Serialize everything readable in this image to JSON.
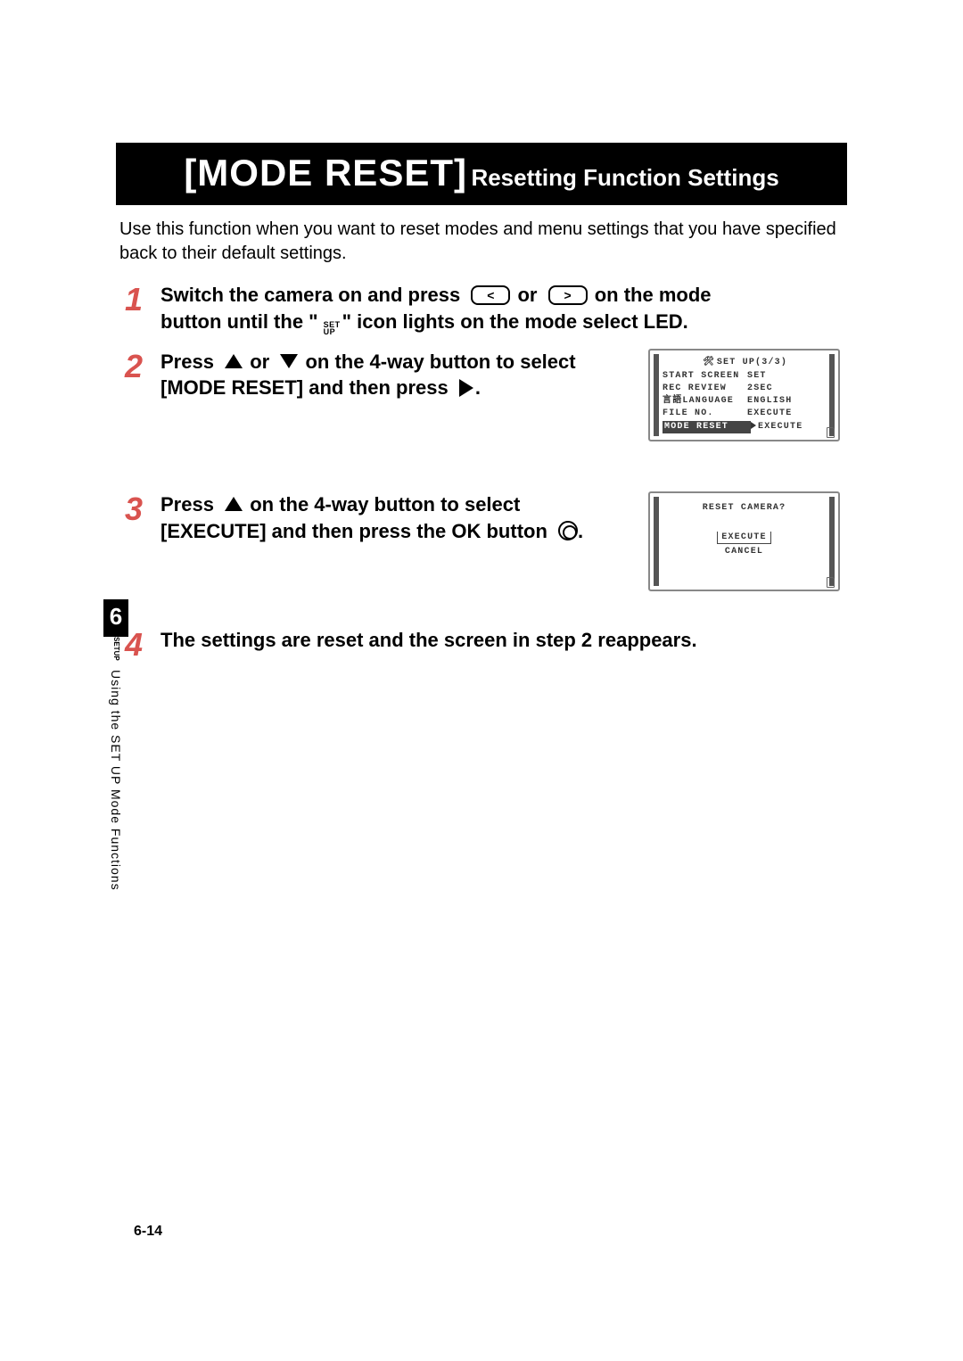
{
  "header": {
    "title_big": "[MODE RESET]",
    "title_small": "Resetting Function Settings"
  },
  "intro": "Use this function when you want to reset modes and menu settings that you have specified back to their default settings.",
  "steps": {
    "s1": {
      "num": "1",
      "pre1": "Switch the camera on and press",
      "or": "or",
      "mid1": "on the mode",
      "line2a": "button until the \"",
      "line2b": "\" icon lights on the mode select LED.",
      "setup_top": "SET",
      "setup_bot": "UP"
    },
    "s2": {
      "num": "2",
      "pre": "Press",
      "or": "or",
      "mid": "on the 4-way button to select",
      "line2": "[MODE RESET] and then press",
      "dot": "."
    },
    "s3": {
      "num": "3",
      "pre": "Press",
      "mid": "on the 4-way button to select",
      "line2": "[EXECUTE] and then press the OK button",
      "dot": "."
    },
    "s4": {
      "num": "4",
      "text": "The settings are reset and the screen in step 2 reappears."
    }
  },
  "lcd1": {
    "title": "SET UP(3/3)",
    "rows": [
      {
        "k": "START SCREEN",
        "v": "SET"
      },
      {
        "k": "REC REVIEW",
        "v": "2SEC"
      },
      {
        "k": "言語LANGUAGE",
        "v": "ENGLISH"
      },
      {
        "k": "FILE NO.",
        "v": "EXECUTE"
      }
    ],
    "sel": {
      "k": "MODE RESET",
      "v": "EXECUTE"
    }
  },
  "lcd2": {
    "title": "RESET CAMERA?",
    "opt1": "EXECUTE",
    "opt2": "CANCEL"
  },
  "side": {
    "chapter": "6",
    "setup_top": "SET",
    "setup_bot": "UP",
    "text": "Using the SET UP Mode Functions"
  },
  "page_number": "6-14"
}
